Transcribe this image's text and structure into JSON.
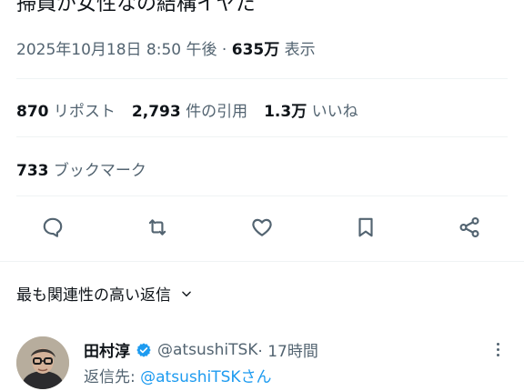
{
  "tweet": {
    "text": "掃員が女性なの結構イヤだ",
    "timestamp": "2025年10月18日 8:50 午後",
    "separator": " · ",
    "views_count": "635万",
    "views_label": " 表示"
  },
  "stats": {
    "reposts": {
      "count": "870",
      "label": " リポスト"
    },
    "quotes": {
      "count": "2,793",
      "label": " 件の引用"
    },
    "likes": {
      "count": "1.3万",
      "label": " いいね"
    },
    "bookmarks": {
      "count": "733",
      "label": " ブックマーク"
    }
  },
  "actions": [
    {
      "name": "reply",
      "icon": "reply-icon"
    },
    {
      "name": "repost",
      "icon": "repost-icon"
    },
    {
      "name": "like",
      "icon": "heart-icon"
    },
    {
      "name": "bookmark",
      "icon": "bookmark-icon"
    },
    {
      "name": "share",
      "icon": "share-icon"
    }
  ],
  "sort": {
    "label": "最も関連性の高い返信",
    "icon": "chevron-down-icon"
  },
  "reply": {
    "author_name": "田村淳",
    "handle": "@atsushiTSK",
    "time": " · 17時間",
    "reply_to_label": "返信先: ",
    "reply_to_mention": "@atsushiTSKさん"
  },
  "colors": {
    "text": "#0f1419",
    "secondary": "#536471",
    "accent": "#1d9bf0",
    "divider": "#eff3f4"
  }
}
